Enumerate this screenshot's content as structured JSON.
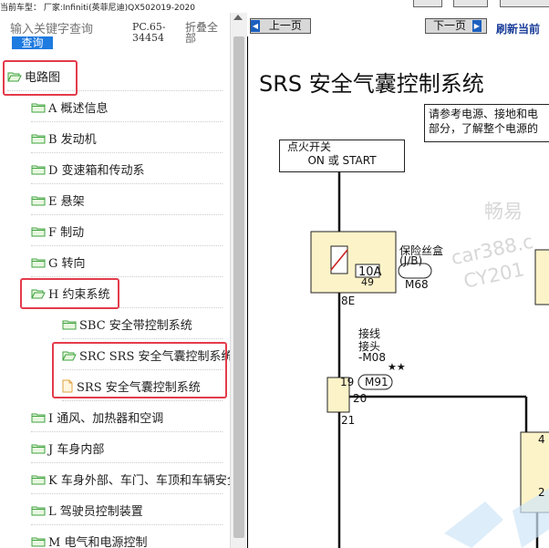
{
  "top_bar": {
    "vehicle": "当前车型： 厂家:Infiniti(英菲尼迪)QX502019-2020"
  },
  "search": {
    "placeholder": "输入关键字查询",
    "button": "查询"
  },
  "pc_code": "PC.65-34454",
  "collapse_all": "折叠全部",
  "tree": [
    {
      "label": "电路图",
      "icon": "folder-open-icon"
    },
    {
      "label": "A 概述信息",
      "icon": "folder-icon"
    },
    {
      "label": "B 发动机",
      "icon": "folder-icon"
    },
    {
      "label": "D 变速箱和传动系",
      "icon": "folder-icon"
    },
    {
      "label": "E 悬架",
      "icon": "folder-icon"
    },
    {
      "label": "F 制动",
      "icon": "folder-icon"
    },
    {
      "label": "G 转向",
      "icon": "folder-icon"
    },
    {
      "label": "H 约束系统",
      "icon": "folder-open-icon"
    },
    {
      "label": "SBC 安全带控制系统",
      "icon": "folder-icon"
    },
    {
      "label": "SRC SRS 安全气囊控制系统",
      "icon": "folder-open-icon"
    },
    {
      "label": "SRS 安全气囊控制系统",
      "icon": "file-icon"
    },
    {
      "label": "I 通风、加热器和空调",
      "icon": "folder-icon"
    },
    {
      "label": "J 车身内部",
      "icon": "folder-icon"
    },
    {
      "label": "K 车身外部、车门、车顶和车辆安全",
      "icon": "folder-icon"
    },
    {
      "label": "L 驾驶员控制装置",
      "icon": "folder-icon"
    },
    {
      "label": "M 电气和电源控制",
      "icon": "folder-icon"
    }
  ],
  "nav": {
    "prev": "上一页",
    "next": "下一页",
    "refresh": "刷新当前"
  },
  "doc": {
    "title": "SRS 安全气囊控制系统",
    "note_line1": "请参考电源、接地和电",
    "note_line2": "部分，了解整个电源的",
    "ignition_line1": "点火开关",
    "ignition_line2": "ON 或 START",
    "fuse_amp": "10A",
    "fuse_num": "49",
    "fuse_box_label": "保险丝盒",
    "fuse_box_sub": "(J/B)",
    "fuse_conn": "M68",
    "pin_8e": "8E",
    "joint_line1": "接线",
    "joint_line2": "接头",
    "joint_line3": "-M08",
    "stars": "★★",
    "conn_m91": "M91",
    "pin_19": "19",
    "pin_20": "20",
    "pin_21": "21",
    "pin_4": "4",
    "pin_2": "2",
    "watermark1": "畅易",
    "watermark2": "car388.c",
    "watermark3": "CY201"
  },
  "colors": {
    "highlight": "#e33b4a",
    "folder": "#3fa33f",
    "accent": "#1e7be0",
    "component": "#fdf3c8"
  }
}
